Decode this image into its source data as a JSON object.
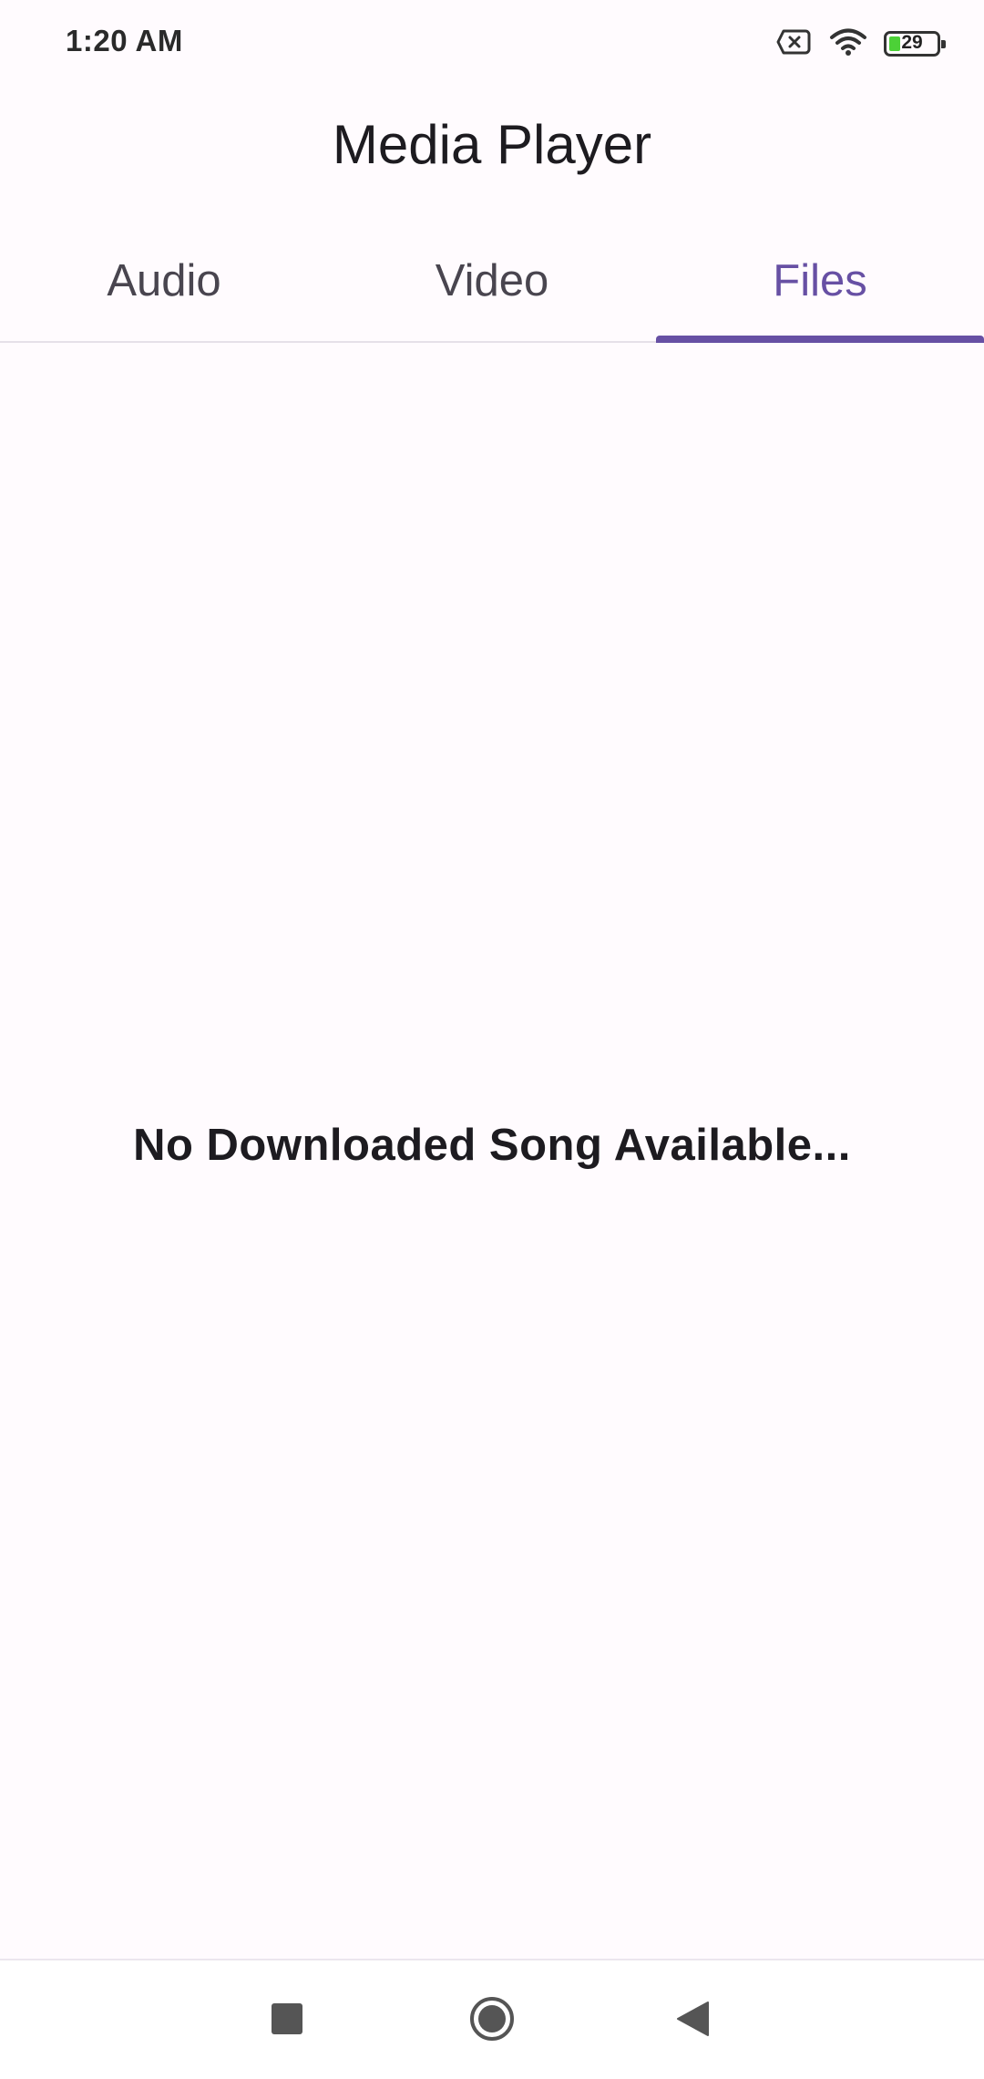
{
  "status_bar": {
    "time": "1:20 AM",
    "battery_level": "29",
    "icons": [
      "sim-off-icon",
      "wifi-icon",
      "battery-icon"
    ]
  },
  "app": {
    "title": "Media Player"
  },
  "tabs": [
    {
      "label": "Audio",
      "active": false
    },
    {
      "label": "Video",
      "active": false
    },
    {
      "label": "Files",
      "active": true
    }
  ],
  "content": {
    "empty_message": "No Downloaded Song Available..."
  },
  "nav_bar": {
    "buttons": [
      "recents-square-icon",
      "home-circle-icon",
      "back-triangle-icon"
    ]
  },
  "colors": {
    "accent": "#6750a4",
    "background": "#fffbfe",
    "battery_fill": "#4cd137"
  }
}
